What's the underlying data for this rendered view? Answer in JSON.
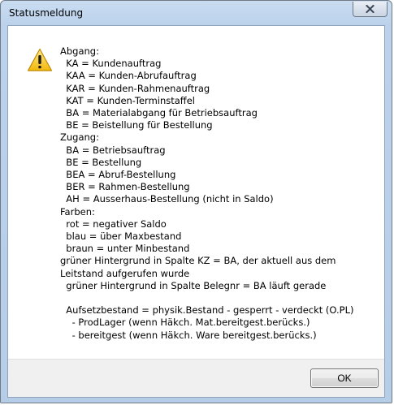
{
  "window": {
    "title": "Statusmeldung",
    "close_icon": "close-icon"
  },
  "dialog": {
    "icon": "warning-icon",
    "message_lines": [
      "Abgang:",
      "  KA = Kundenauftrag",
      "  KAA = Kunden-Abrufauftrag",
      "  KAR = Kunden-Rahmenauftrag",
      "  KAT = Kunden-Terminstaffel",
      "  BA = Materialabgang für Betriebsauftrag",
      "  BE = Beistellung für Bestellung",
      "Zugang:",
      "  BA = Betriebsauftrag",
      "  BE = Bestellung",
      "  BEA = Abruf-Bestellung",
      "  BER = Rahmen-Bestellung",
      "  AH = Ausserhaus-Bestellung (nicht in Saldo)",
      "Farben:",
      "  rot = negativer Saldo",
      "  blau = über Maxbestand",
      "  braun = unter Minbestand",
      "  grüner Hintergrund in Spalte KZ = BA, der aktuell aus dem Leitstand aufgerufen wurde",
      "  grüner Hintergrund in Spalte Belegnr = BA läuft gerade",
      "",
      "  Aufsetzbestand = physik.Bestand - gesperrt - verdeckt (O.PL)",
      "    - ProdLager (wenn Häkch. Mat.bereitgest.berücks.)",
      "    - bereitgest (wenn Häkch. Ware bereitgest.berücks.)"
    ],
    "ok_label": "OK"
  }
}
